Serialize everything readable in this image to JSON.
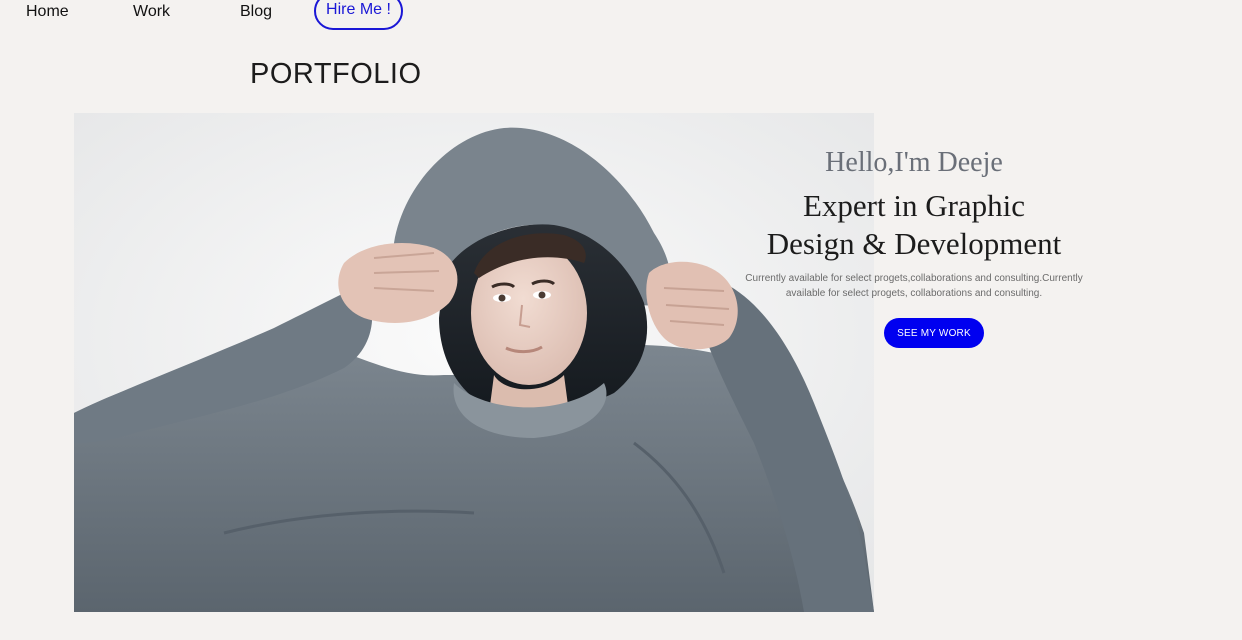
{
  "nav": {
    "home_label": "Home",
    "work_label": "Work",
    "blog_label": "Blog",
    "hire_label": "Hire Me !"
  },
  "page_title": "PORTFOLIO",
  "hero": {
    "greeting": "Hello,I'm Deeje",
    "headline_line1": "Expert in Graphic",
    "headline_line2": "Design & Development",
    "intro_line1": "Currently available for select progets,collaborations and consulting.Currently",
    "intro_line2": "available for select progets, collaborations and consulting.",
    "cta_label": "SEE MY WORK"
  },
  "colors": {
    "background": "#f4f2f0",
    "accent": "#0000f0",
    "hire_outline": "#1a17d6"
  },
  "image": {
    "subject": "young man in grey hoodie pulling hood over head"
  }
}
